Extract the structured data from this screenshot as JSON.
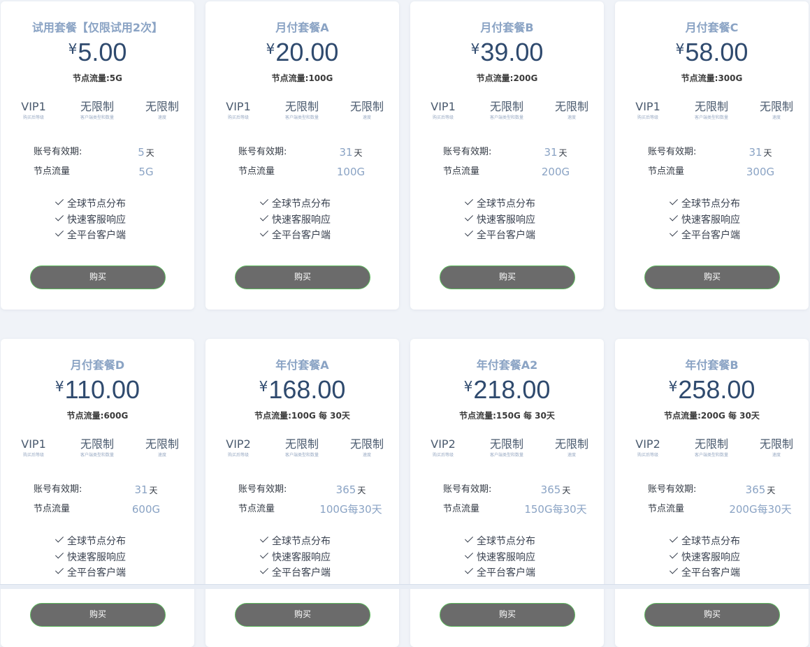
{
  "currency": "¥",
  "labels": {
    "level_caption": "购买后等级",
    "clients_caption": "客户端类型和数量",
    "speed_caption": "速度",
    "validity": "账号有效期:",
    "traffic": "节点流量",
    "day_unit": "天",
    "buy": "购买"
  },
  "features": [
    "全球节点分布",
    "快速客服响应",
    "全平台客户端"
  ],
  "colors": {
    "page_bg": "#f0f3f8",
    "card_bg": "#ffffff",
    "title": "#8aa3c4",
    "price": "#2f4a6e",
    "button_bg": "#6b6b6b",
    "button_border": "#5cb85c"
  },
  "plans": [
    {
      "title": "试用套餐【仅限试用2次】",
      "price": "5.00",
      "traffic_line": "节点流量:5G",
      "level": "VIP1",
      "clients": "无限制",
      "speed": "无限制",
      "validity": "5",
      "traffic": "5G"
    },
    {
      "title": "月付套餐A",
      "price": "20.00",
      "traffic_line": "节点流量:100G",
      "level": "VIP1",
      "clients": "无限制",
      "speed": "无限制",
      "validity": "31",
      "traffic": "100G"
    },
    {
      "title": "月付套餐B",
      "price": "39.00",
      "traffic_line": "节点流量:200G",
      "level": "VIP1",
      "clients": "无限制",
      "speed": "无限制",
      "validity": "31",
      "traffic": "200G"
    },
    {
      "title": "月付套餐C",
      "price": "58.00",
      "traffic_line": "节点流量:300G",
      "level": "VIP1",
      "clients": "无限制",
      "speed": "无限制",
      "validity": "31",
      "traffic": "300G"
    },
    {
      "title": "月付套餐D",
      "price": "110.00",
      "traffic_line": "节点流量:600G",
      "level": "VIP1",
      "clients": "无限制",
      "speed": "无限制",
      "validity": "31",
      "traffic": "600G"
    },
    {
      "title": "年付套餐A",
      "price": "168.00",
      "traffic_line": "节点流量:100G 每 30天",
      "level": "VIP2",
      "clients": "无限制",
      "speed": "无限制",
      "validity": "365",
      "traffic": "100G每30天"
    },
    {
      "title": "年付套餐A2",
      "price": "218.00",
      "traffic_line": "节点流量:150G 每 30天",
      "level": "VIP2",
      "clients": "无限制",
      "speed": "无限制",
      "validity": "365",
      "traffic": "150G每30天"
    },
    {
      "title": "年付套餐B",
      "price": "258.00",
      "traffic_line": "节点流量:200G 每 30天",
      "level": "VIP2",
      "clients": "无限制",
      "speed": "无限制",
      "validity": "365",
      "traffic": "200G每30天"
    }
  ]
}
